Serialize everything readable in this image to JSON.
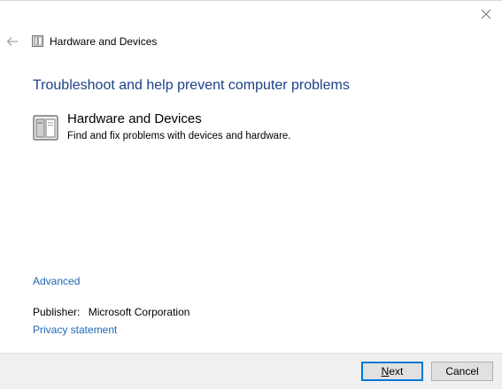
{
  "window": {
    "close_icon": "close-icon"
  },
  "header": {
    "back_icon": "back-arrow-icon",
    "app_icon": "hardware-devices-icon",
    "title": "Hardware and Devices"
  },
  "main": {
    "heading": "Troubleshoot and help prevent computer problems",
    "item": {
      "icon": "hardware-devices-icon",
      "title": "Hardware and Devices",
      "description": "Find and fix problems with devices and hardware."
    },
    "advanced_link": "Advanced",
    "publisher_label": "Publisher:",
    "publisher_value": "Microsoft Corporation",
    "privacy_link": "Privacy statement"
  },
  "footer": {
    "next_accel": "N",
    "next_rest": "ext",
    "cancel_label": "Cancel"
  },
  "colors": {
    "heading": "#1e3f87",
    "link": "#1f68b3",
    "footer_bg": "#f0f0f0",
    "default_button_border": "#0078d7"
  }
}
